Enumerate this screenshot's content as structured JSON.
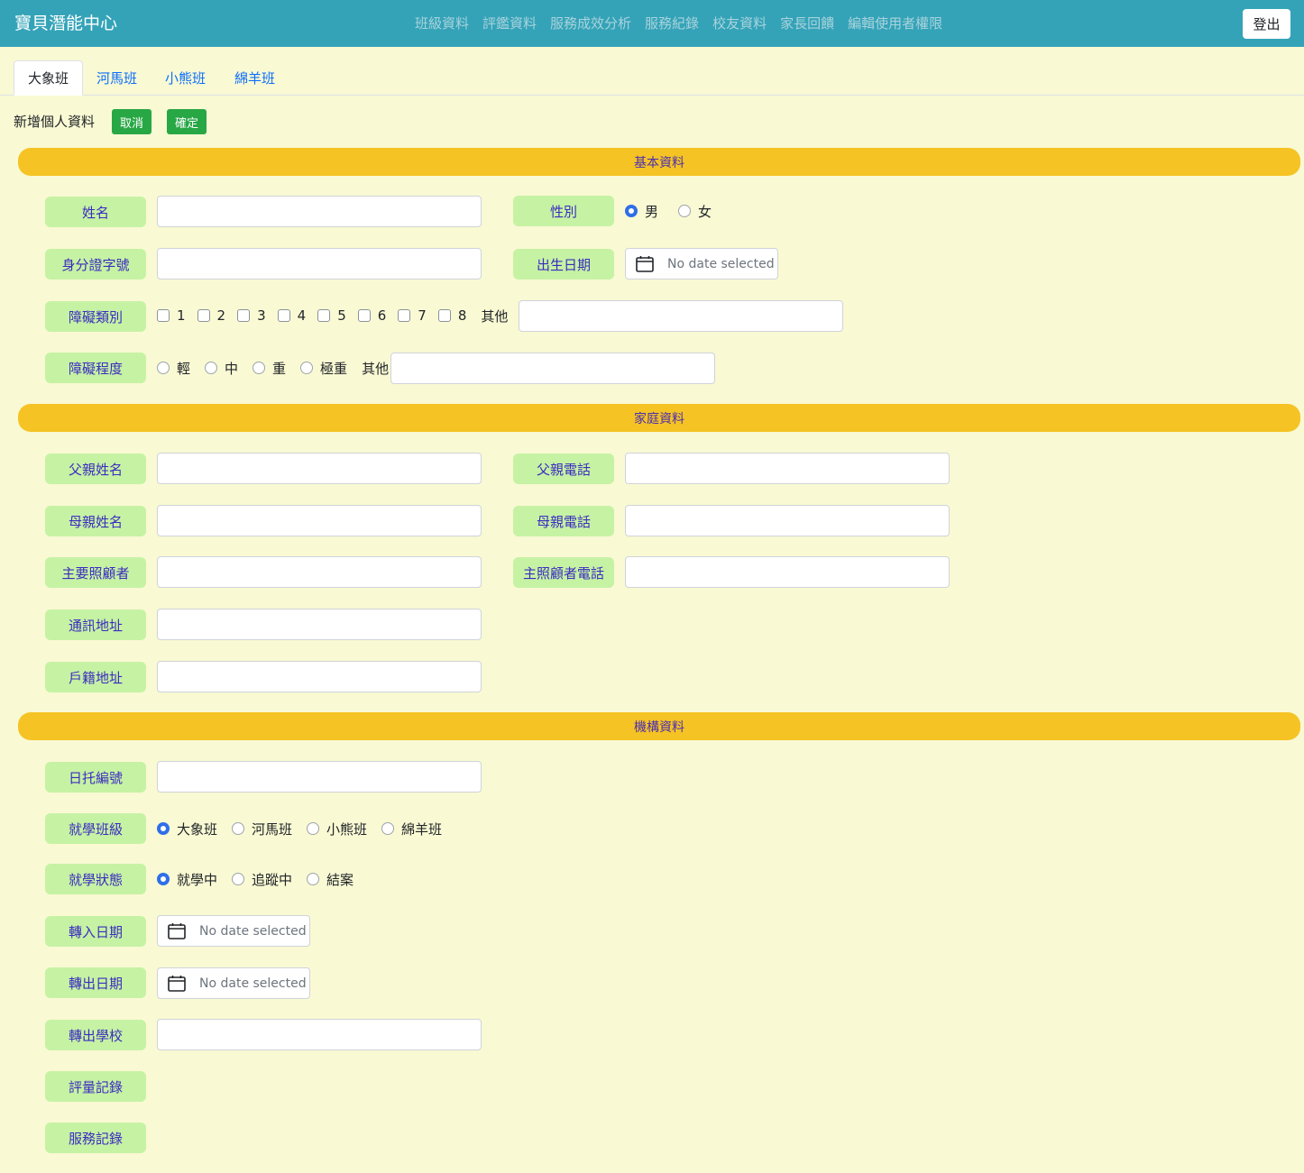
{
  "app": {
    "brand": "寶貝潛能中心",
    "nav": [
      "班級資料",
      "評鑑資料",
      "服務成效分析",
      "服務紀錄",
      "校友資料",
      "家長回饋",
      "編輯使用者權限"
    ],
    "logout": "登出"
  },
  "tabs": [
    "大象班",
    "河馬班",
    "小熊班",
    "綿羊班"
  ],
  "active_tab": "大象班",
  "toolbar": {
    "title": "新增個人資料",
    "cancel": "取消",
    "confirm": "確定"
  },
  "sections": {
    "basic": "基本資料",
    "family": "家庭資料",
    "institution": "機構資料"
  },
  "basic": {
    "name_label": "姓名",
    "gender_label": "性別",
    "gender_options": [
      "男",
      "女"
    ],
    "gender_selected": "男",
    "id_label": "身分證字號",
    "birth_label": "出生日期",
    "birth_value": "No date selected",
    "disability_type_label": "障礙類別",
    "disability_type_options": [
      "1",
      "2",
      "3",
      "4",
      "5",
      "6",
      "7",
      "8"
    ],
    "disability_type_other": "其他",
    "disability_level_label": "障礙程度",
    "disability_level_options": [
      "輕",
      "中",
      "重",
      "極重"
    ],
    "disability_level_other": "其他"
  },
  "family": {
    "father_name_label": "父親姓名",
    "father_phone_label": "父親電話",
    "mother_name_label": "母親姓名",
    "mother_phone_label": "母親電話",
    "caregiver_label": "主要照顧者",
    "caregiver_phone_label": "主照顧者電話",
    "mail_address_label": "通訊地址",
    "home_address_label": "戶籍地址"
  },
  "institution": {
    "daycare_id_label": "日托編號",
    "class_label": "就學班級",
    "class_options": [
      "大象班",
      "河馬班",
      "小熊班",
      "綿羊班"
    ],
    "class_selected": "大象班",
    "status_label": "就學狀態",
    "status_options": [
      "就學中",
      "追蹤中",
      "結案"
    ],
    "status_selected": "就學中",
    "transfer_in_label": "轉入日期",
    "transfer_in_value": "No date selected",
    "transfer_out_label": "轉出日期",
    "transfer_out_value": "No date selected",
    "transfer_school_label": "轉出學校",
    "assessment_label": "評量記錄",
    "service_label": "服務記錄"
  },
  "colors": {
    "navbar": "#34a3b8",
    "page_bg": "#f9f9d3",
    "section_bar": "#f5c323",
    "field_label_bg": "#c6f2a4",
    "field_label_text": "#3a2cc0",
    "button_green": "#28a745",
    "radio_checked": "#2f6fe8"
  },
  "icons": {
    "date": "calendar-icon"
  }
}
